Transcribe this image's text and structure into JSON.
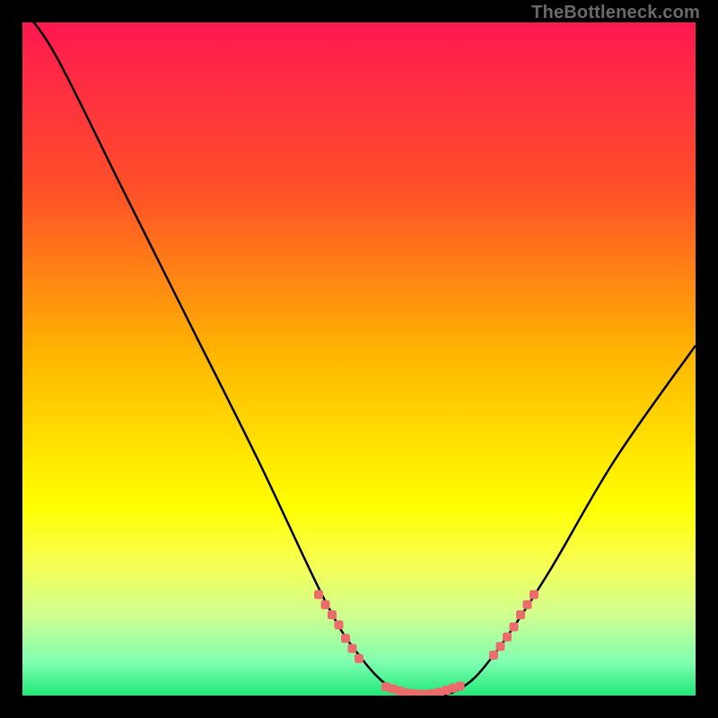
{
  "watermark": "TheBottleneck.com",
  "chart_data": {
    "type": "line",
    "title": "",
    "xlabel": "",
    "ylabel": "",
    "xlim": [
      0,
      100
    ],
    "ylim": [
      0,
      100
    ],
    "gradient_stops": [
      {
        "offset": 0,
        "color": "#ff1850"
      },
      {
        "offset": 25,
        "color": "#ff5028"
      },
      {
        "offset": 50,
        "color": "#ffb800"
      },
      {
        "offset": 72,
        "color": "#ffff00"
      },
      {
        "offset": 80,
        "color": "#f8ff50"
      },
      {
        "offset": 88,
        "color": "#d0ff90"
      },
      {
        "offset": 95,
        "color": "#80ffb0"
      },
      {
        "offset": 100,
        "color": "#20e878"
      }
    ],
    "curve": [
      {
        "x": 0,
        "y": 102
      },
      {
        "x": 5,
        "y": 95
      },
      {
        "x": 15,
        "y": 75
      },
      {
        "x": 25,
        "y": 55
      },
      {
        "x": 35,
        "y": 35
      },
      {
        "x": 45,
        "y": 14
      },
      {
        "x": 50,
        "y": 6
      },
      {
        "x": 55,
        "y": 1
      },
      {
        "x": 60,
        "y": 0
      },
      {
        "x": 65,
        "y": 1
      },
      {
        "x": 70,
        "y": 6
      },
      {
        "x": 78,
        "y": 18
      },
      {
        "x": 88,
        "y": 35
      },
      {
        "x": 100,
        "y": 52
      }
    ],
    "markers_left": [
      {
        "x": 44,
        "y": 15
      },
      {
        "x": 45,
        "y": 13.5
      },
      {
        "x": 46,
        "y": 12
      },
      {
        "x": 47,
        "y": 10.5
      },
      {
        "x": 48,
        "y": 8.5
      },
      {
        "x": 49,
        "y": 7
      },
      {
        "x": 50,
        "y": 5.5
      }
    ],
    "markers_bottom": [
      {
        "x": 54,
        "y": 1.3
      },
      {
        "x": 55,
        "y": 1
      },
      {
        "x": 56,
        "y": 0.7
      },
      {
        "x": 57,
        "y": 0.4
      },
      {
        "x": 58,
        "y": 0.3
      },
      {
        "x": 59,
        "y": 0.2
      },
      {
        "x": 60,
        "y": 0.2
      },
      {
        "x": 61,
        "y": 0.3
      },
      {
        "x": 62,
        "y": 0.5
      },
      {
        "x": 63,
        "y": 0.8
      },
      {
        "x": 64,
        "y": 1.1
      },
      {
        "x": 65,
        "y": 1.4
      }
    ],
    "markers_right": [
      {
        "x": 70,
        "y": 6
      },
      {
        "x": 71,
        "y": 7.3
      },
      {
        "x": 72,
        "y": 8.7
      },
      {
        "x": 73,
        "y": 10.2
      },
      {
        "x": 74,
        "y": 12
      },
      {
        "x": 75,
        "y": 13.5
      },
      {
        "x": 76,
        "y": 15
      }
    ],
    "marker_color": "#ec6b6b",
    "curve_color": "#000000"
  }
}
